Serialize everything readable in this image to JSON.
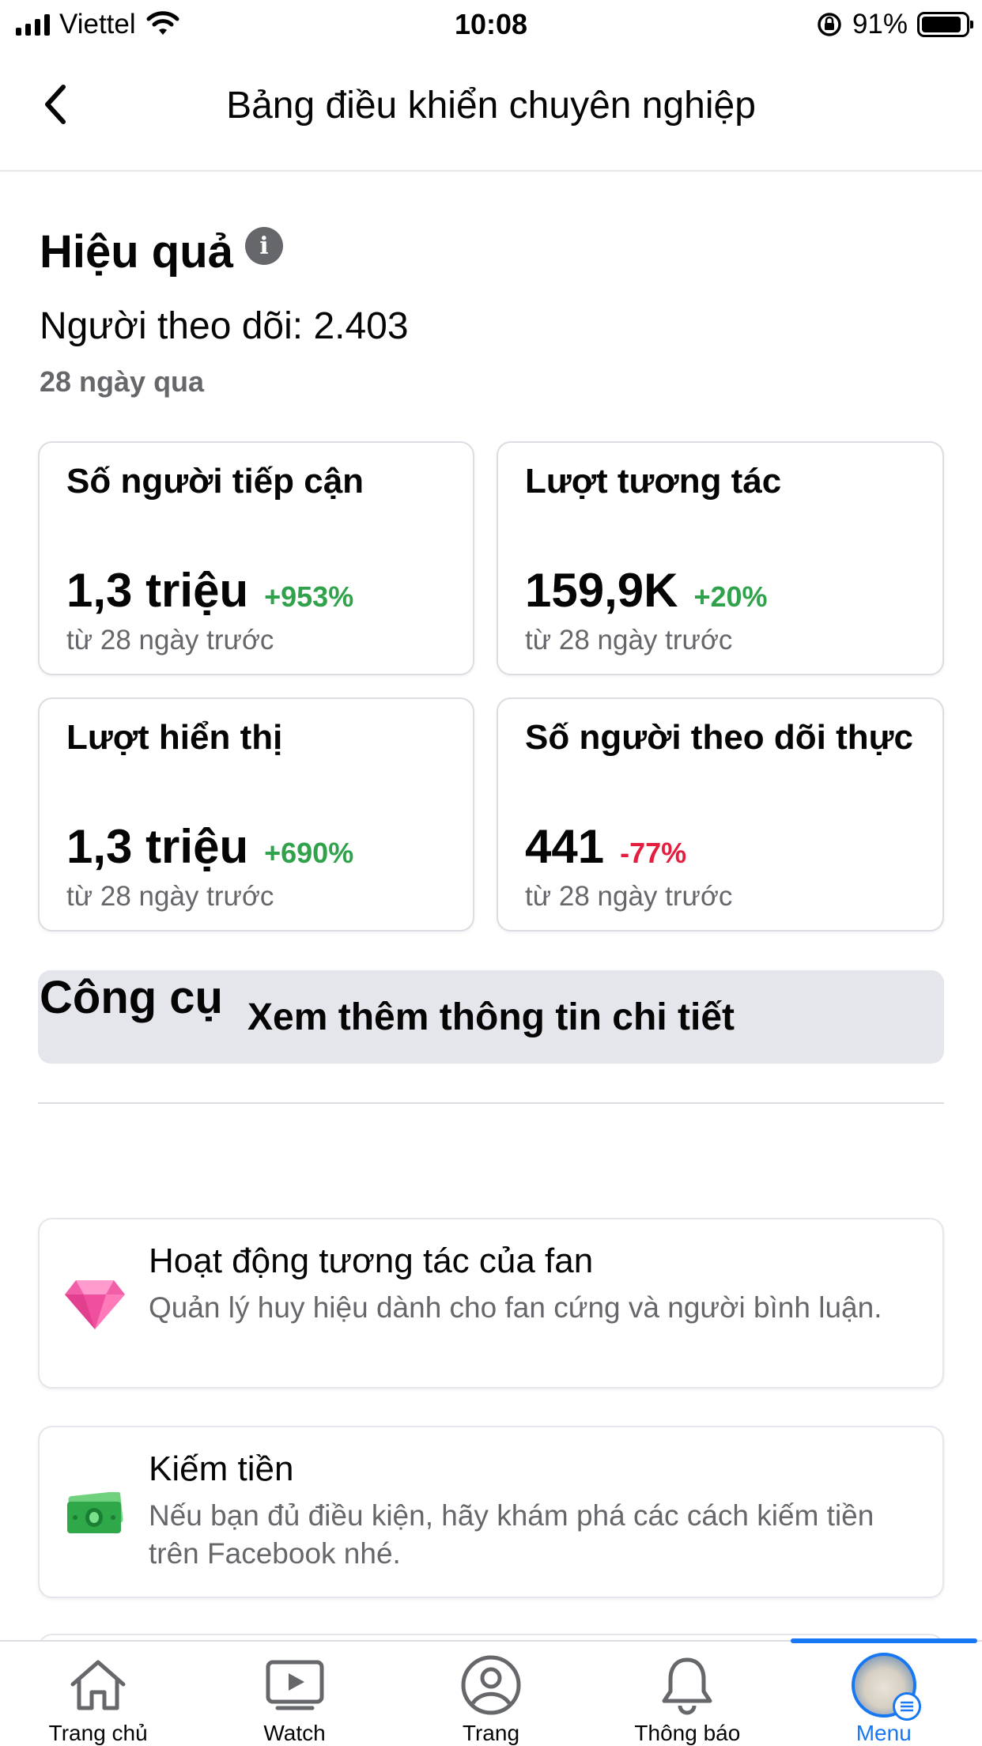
{
  "status_bar": {
    "carrier": "Viettel",
    "time": "10:08",
    "battery": "91%",
    "battery_level": 0.91
  },
  "header": {
    "title": "Bảng điều khiển chuyên nghiệp"
  },
  "performance": {
    "title": "Hiệu quả",
    "followers": "Người theo dõi: 2.403",
    "period": "28 ngày qua",
    "cards": [
      {
        "title": "Số người tiếp cận",
        "value": "1,3 triệu",
        "change": "+953%",
        "sub": "từ 28 ngày trước"
      },
      {
        "title": "Lượt tương tác",
        "value": "159,9K",
        "change": "+20%",
        "sub": "từ 28 ngày trước"
      },
      {
        "title": "Lượt hiển thị",
        "value": "1,3 triệu",
        "change": "+690%",
        "sub": "từ 28 ngày trước"
      },
      {
        "title": "Số người theo dõi thực",
        "value": "441",
        "change": "-77%",
        "sub": "từ 28 ngày trước"
      }
    ],
    "more_button": "Xem thêm thông tin chi tiết"
  },
  "tools": {
    "title": "Công cụ",
    "items": [
      {
        "icon": "diamond-icon",
        "title": "Hoạt động tương tác của fan",
        "desc": "Quản lý huy hiệu dành cho fan cứng và người bình luận."
      },
      {
        "icon": "money-icon",
        "title": "Kiếm tiền",
        "desc": "Nếu bạn đủ điều kiện, hãy khám phá các cách kiếm tiền trên Facebook nhé."
      }
    ]
  },
  "tab_bar": {
    "tabs": [
      {
        "label": "Trang chủ",
        "icon": "home-icon"
      },
      {
        "label": "Watch",
        "icon": "watch-icon"
      },
      {
        "label": "Trang",
        "icon": "profile-icon"
      },
      {
        "label": "Thông báo",
        "icon": "bell-icon"
      },
      {
        "label": "Menu",
        "icon": "avatar"
      }
    ],
    "active": "Menu"
  },
  "colors": {
    "positive": "#31a24c",
    "negative": "#e41e3f",
    "accent": "#1877f2"
  }
}
